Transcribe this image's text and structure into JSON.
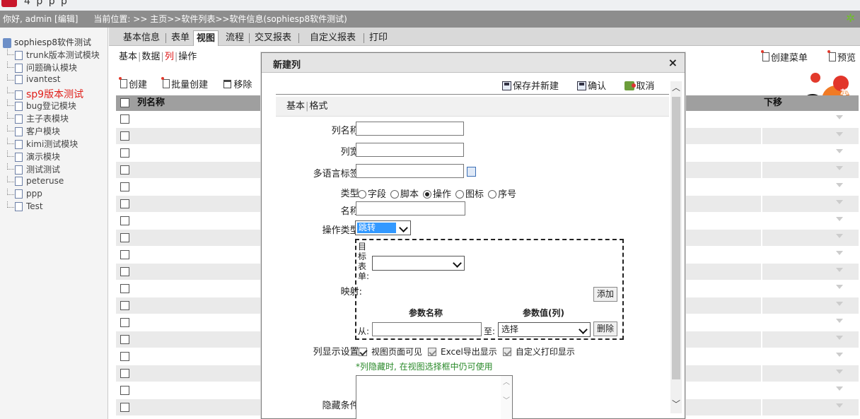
{
  "app": {
    "logo_text": "4  p  p  p"
  },
  "status": {
    "greeting": "你好, admin [编辑]",
    "location": "当前位置: >> 主页>>软件列表>>软件信息(sophiesp8软件测试)"
  },
  "sidebar": {
    "root": "sophiesp8软件测试",
    "items": [
      {
        "label": "trunk版本测试模块"
      },
      {
        "label": "问题确认模块"
      },
      {
        "label": "ivantest"
      },
      {
        "label": "sp9版本测试"
      },
      {
        "label": "bug登记模块"
      },
      {
        "label": "主子表模块"
      },
      {
        "label": "客户模块"
      },
      {
        "label": "kimi测试模块"
      },
      {
        "label": "演示模块"
      },
      {
        "label": "测试测试"
      },
      {
        "label": "peteruse"
      },
      {
        "label": "ppp"
      },
      {
        "label": "Test"
      }
    ],
    "active_index": 3
  },
  "tabs": [
    {
      "label": "基本信息"
    },
    {
      "label": "表单"
    },
    {
      "label": "视图"
    },
    {
      "label": "流程"
    },
    {
      "label": "交叉报表"
    },
    {
      "label": "自定义报表"
    },
    {
      "label": "打印"
    }
  ],
  "subtabs": {
    "basic": "基本",
    "data": "数据",
    "column": "列",
    "action": "操作"
  },
  "right_toolbar": {
    "create_menu": "创建菜单",
    "preview": "预览"
  },
  "decoration": {
    "badge_text": "英"
  },
  "list_toolbar": {
    "create": "创建",
    "batch_create": "批量创建",
    "remove": "移除"
  },
  "grid": {
    "col_name": "列名称",
    "col_down": "下移",
    "row_count": 18
  },
  "dialog": {
    "title": "新建列",
    "close": "×",
    "save_and_new": "保存并新建",
    "confirm": "确认",
    "cancel": "取消",
    "tab_basic": "基本",
    "tab_format": "格式",
    "labels": {
      "col_name": "列名称:",
      "col_width": "列宽:",
      "i18n": "多语言标签:",
      "type": "类型:",
      "name": "名称:",
      "op_type": "操作类型:",
      "mapping": "映射:",
      "display": "列显示设置:",
      "hide_cond": "隐藏条件:"
    },
    "fields": {
      "col_name": "",
      "col_width": "",
      "i18n": "",
      "name": ""
    },
    "type_options": [
      {
        "label": "字段",
        "checked": false
      },
      {
        "label": "脚本",
        "checked": false
      },
      {
        "label": "操作",
        "checked": true
      },
      {
        "label": "图标",
        "checked": false
      },
      {
        "label": "序号",
        "checked": false
      }
    ],
    "op_type_value": "跳转",
    "mapping": {
      "target_form_label": "目标表单:",
      "target_form_value": "",
      "add_button": "添加",
      "param_name_header": "参数名称",
      "param_value_header": "参数值(列)",
      "from_label": "从:",
      "from_value": "",
      "to_label": "至:",
      "to_value": "选择",
      "delete_button": "删除"
    },
    "display_options": [
      {
        "label": "视图页面可见",
        "checked": true,
        "disabled": false
      },
      {
        "label": "Excel导出显示",
        "checked": true,
        "disabled": true
      },
      {
        "label": "自定义打印显示",
        "checked": true,
        "disabled": true
      }
    ],
    "display_note": "*列隐藏时, 在视图选择框中仍可使用",
    "hide_condition": ""
  },
  "colors": {
    "status_bar": "#8d8d8d",
    "tab_bar": "#d9d9d9",
    "grid_header": "#9f9f9f",
    "active_tree_item": "#e0201b",
    "note_green": "#2a8a2a",
    "select_highlight": "#3399ff"
  }
}
